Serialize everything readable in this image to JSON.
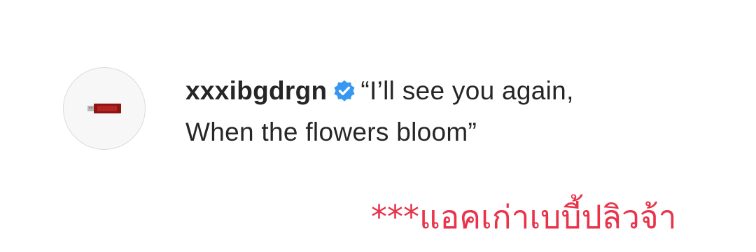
{
  "post": {
    "username": "xxxibgdrgn",
    "verified_icon": "verified-badge-icon",
    "avatar_icon": "usb-drive-icon",
    "caption_line1": "“I’ll see you again,",
    "caption_line2": "When the flowers bloom”"
  },
  "overlay_note": "***แอคเก่าเบบี้ปลิวจ้า",
  "colors": {
    "text": "#262626",
    "verified_blue": "#3897f0",
    "note_red": "#e8334a"
  }
}
